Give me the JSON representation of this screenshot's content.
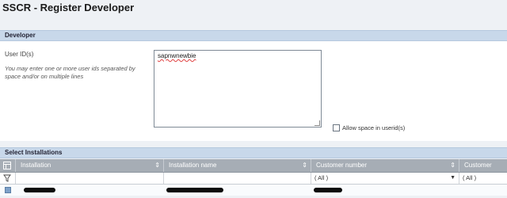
{
  "page": {
    "title": "SSCR - Register Developer"
  },
  "developer_section": {
    "header": "Developer",
    "userid_label": "User ID(s)",
    "hint": "You may enter one or more user ids separated by space and/or on multiple lines",
    "userid_value": "sapnwnewbie",
    "allow_space_label": "Allow space in userid(s)",
    "allow_space_checked": false
  },
  "installations_section": {
    "header": "Select Installations",
    "columns": [
      {
        "label": "Installation"
      },
      {
        "label": "Installation name"
      },
      {
        "label": "Customer number"
      },
      {
        "label": "Customer name"
      }
    ],
    "filter": {
      "customer_number": "( All )",
      "customer_name": "( All )"
    },
    "rows": [
      {
        "installation": "",
        "installation_name": "",
        "customer_number": ""
      }
    ]
  },
  "colors": {
    "section_bar": "#c8d8ea",
    "table_header": "#a6adb5",
    "row_marker": "#7ea1c9"
  }
}
